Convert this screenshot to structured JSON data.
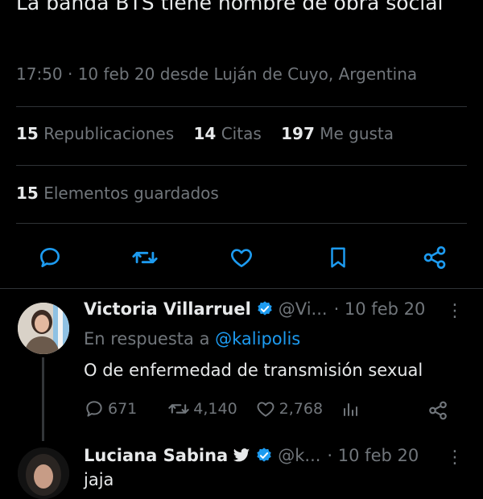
{
  "tweet": {
    "text": "La banda BTS tiene nombre de obra social",
    "meta": "17:50 · 10 feb 20 desde Luján de Cuyo, Argentina",
    "stats": [
      {
        "count": "15",
        "label": "Republicaciones"
      },
      {
        "count": "14",
        "label": "Citas"
      },
      {
        "count": "197",
        "label": "Me gusta"
      }
    ],
    "saved": {
      "count": "15",
      "label": "Elementos guardados"
    }
  },
  "icons": [
    "reply-icon",
    "retweet-icon",
    "like-icon",
    "bookmark-icon",
    "share-icon"
  ],
  "colors": {
    "accent": "#1d9bf0",
    "muted": "#71767b",
    "text": "#e7e9ea",
    "background": "#000000"
  },
  "replies": [
    {
      "name": "Victoria Villarruel",
      "handle": "@Vi...",
      "date": "· 10 feb 20",
      "reply_to_prefix": "En respuesta a",
      "reply_to_mention": "@kalipolis",
      "text": "O de enfermedad de transmisión sexual",
      "replies": "671",
      "retweets": "4,140",
      "likes": "2,768"
    },
    {
      "name": "Luciana Sabina",
      "handle": "@k...",
      "date": "· 10 feb 20",
      "text": "jaja"
    }
  ]
}
